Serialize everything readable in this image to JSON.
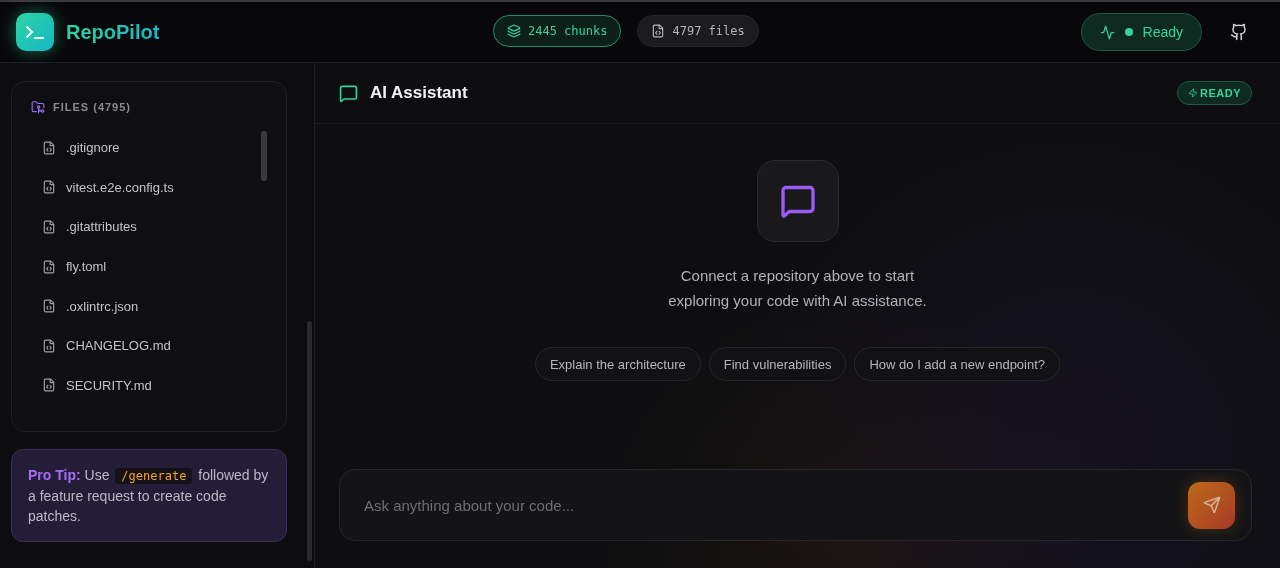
{
  "app": {
    "name": "RepoPilot"
  },
  "stats": [
    {
      "kind": "chunks",
      "label": "2445 chunks"
    },
    {
      "kind": "files",
      "label": "4797 files"
    }
  ],
  "status": {
    "label": "Ready",
    "online": true
  },
  "files": {
    "title": "FILES (4795)",
    "items": [
      ".gitignore",
      "vitest.e2e.config.ts",
      ".gitattributes",
      "fly.toml",
      ".oxlintrc.json",
      "CHANGELOG.md",
      "SECURITY.md"
    ]
  },
  "tip": {
    "label": "Pro Tip:",
    "before": "Use",
    "code": "/generate",
    "after": "followed by a feature request to create code patches."
  },
  "chat": {
    "title": "AI Assistant",
    "badge": "READY",
    "message": [
      "Connect a repository above to start",
      "exploring your code with AI assistance."
    ],
    "suggestions": [
      "Explain the architecture",
      "Find vulnerabilities",
      "How do I add a new endpoint?"
    ],
    "input": {
      "placeholder": "Ask anything about your code..."
    }
  }
}
